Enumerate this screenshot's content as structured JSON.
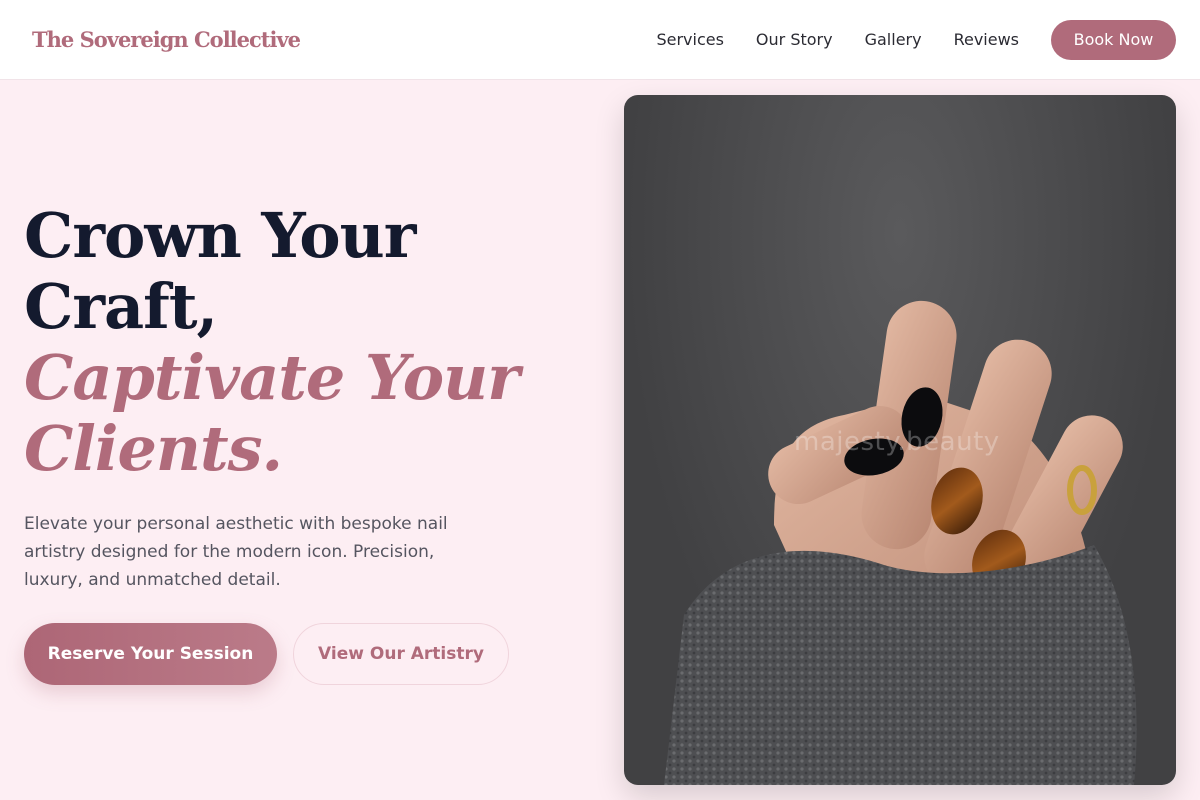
{
  "header": {
    "logo": "The Sovereign Collective",
    "nav": [
      "Services",
      "Our Story",
      "Gallery",
      "Reviews"
    ],
    "cta_label": "Book Now"
  },
  "hero": {
    "headline_line1": "Crown Your",
    "headline_line2": "Craft,",
    "headline_accent_line1": "Captivate Your",
    "headline_accent_line2": "Clients.",
    "subtext": "Elevate your personal aesthetic with bespoke nail artistry designed for the modern icon. Precision, luxury, and unmatched detail.",
    "primary_cta": "Reserve Your Session",
    "secondary_cta": "View Our Artistry"
  },
  "photo": {
    "watermark": "majesty.beauty"
  },
  "colors": {
    "accent": "#b06b7b",
    "background": "#fdeef3",
    "headline": "#141a2e"
  }
}
